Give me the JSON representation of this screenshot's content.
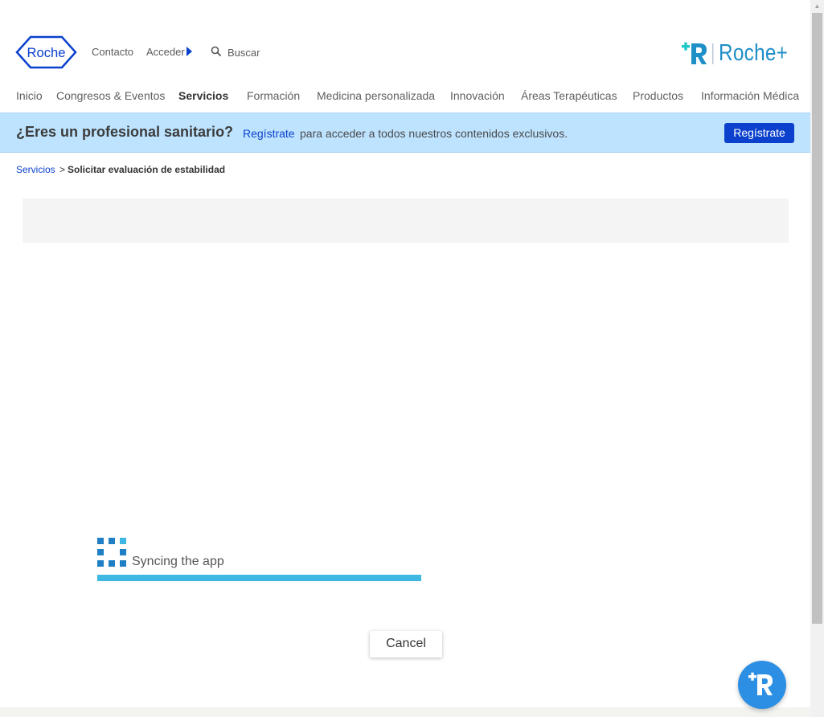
{
  "header": {
    "logo_text": "Roche",
    "contact_label": "Contacto",
    "login_label": "Acceder",
    "search_label": "Buscar",
    "brand_text": "Roche+",
    "icons": {
      "search": "search-icon",
      "login_arrow": "caret-right-icon",
      "brand": "roche-plus-logo"
    }
  },
  "nav": {
    "items": [
      {
        "label": "Inicio"
      },
      {
        "label": "Congresos & Eventos"
      },
      {
        "label": "Servicios",
        "active": true
      },
      {
        "label": "Formación"
      },
      {
        "label": "Medicina personalizada"
      },
      {
        "label": "Innovación"
      },
      {
        "label": "Áreas Terapéuticas"
      },
      {
        "label": "Productos"
      },
      {
        "label": "Información Médica"
      }
    ]
  },
  "banner": {
    "title": "¿Eres un profesional sanitario?",
    "link_text": "Regístrate",
    "message": "para acceder a todos nuestros contenidos exclusivos.",
    "button_label": "Regístrate"
  },
  "breadcrumb": {
    "parent": "Servicios",
    "separator": ">",
    "current": "Solicitar evaluación de estabilidad"
  },
  "sync": {
    "text": "Syncing the app",
    "progress": 1.0
  },
  "dialog": {
    "cancel_label": "Cancel"
  },
  "colors": {
    "accent": "#0b41cd",
    "banner_bg": "#bde3ff",
    "progress": "#3fb8e4",
    "fab": "#2d8fe3"
  }
}
